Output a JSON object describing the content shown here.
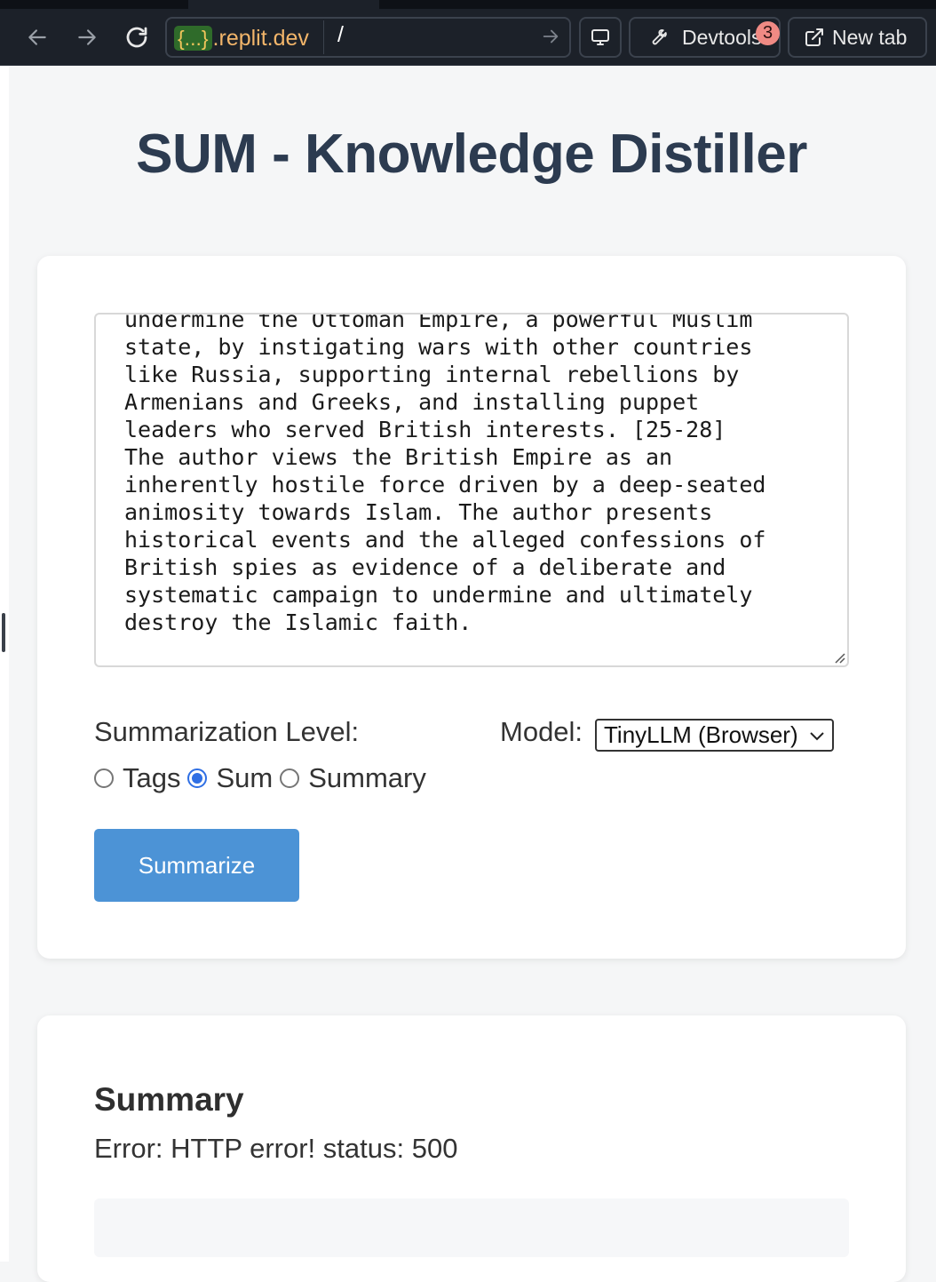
{
  "browser": {
    "url_badge": "{...}",
    "url_host": ".replit.dev",
    "url_path": "/",
    "devtools_label": "Devtools",
    "devtools_badge": "3",
    "new_tab_label": "New tab"
  },
  "page": {
    "title": "SUM - Knowledge Distiller"
  },
  "input": {
    "text": "undermine the Ottoman Empire, a powerful Muslim\nstate, by instigating wars with other countries\nlike Russia, supporting internal rebellions by\nArmenians and Greeks, and installing puppet\nleaders who served British interests. [25-28]\nThe author views the British Empire as an\ninherently hostile force driven by a deep-seated\nanimosity towards Islam. The author presents\nhistorical events and the alleged confessions of\nBritish spies as evidence of a deliberate and\nsystematic campaign to undermine and ultimately\ndestroy the Islamic faith."
  },
  "controls": {
    "level_label": "Summarization Level:",
    "levels": [
      {
        "label": "Tags",
        "checked": false
      },
      {
        "label": "Sum",
        "checked": true
      },
      {
        "label": "Summary",
        "checked": false
      }
    ],
    "model_label": "Model:",
    "model_selected": "TinyLLM (Browser)",
    "summarize_button": "Summarize"
  },
  "output": {
    "heading": "Summary",
    "error": "Error: HTTP error! status: 500"
  },
  "colors": {
    "accent": "#4c93d6",
    "title": "#2c3b50",
    "radio_checked": "#2f6fe4"
  }
}
